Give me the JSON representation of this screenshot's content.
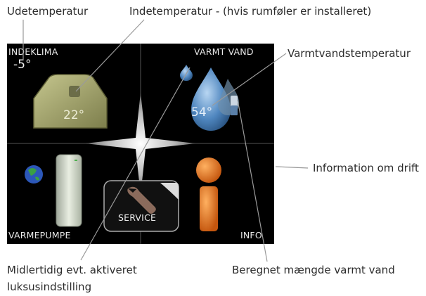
{
  "annotations": {
    "outdoor_temp": "Udetemperatur",
    "indoor_temp": "Indetemperatur - (hvis rumføler er installeret)",
    "hot_water_temp": "Varmtvandstemperatur",
    "operation_info": "Information om drift",
    "luxury_setting_line1": "Midlertidig evt. aktiveret",
    "luxury_setting_line2": "luksusindstilling",
    "hot_water_amount": "Beregnet mængde varmt vand"
  },
  "screen": {
    "indoor_climate": {
      "label": "INDEKLIMA",
      "outdoor_temp": "-5°",
      "indoor_temp": "22°"
    },
    "hot_water": {
      "label": "VARMT VAND",
      "temp": "54°"
    },
    "heat_pump": {
      "label": "VARMEPUMPE"
    },
    "info": {
      "label": "INFO"
    },
    "service": {
      "label": "SERVICE"
    }
  },
  "colors": {
    "screen_bg": "#000000",
    "house": "#a3a46a",
    "water": "#5b8ec2",
    "info_orange": "#e07a22",
    "leader": "#9a9a9a"
  }
}
